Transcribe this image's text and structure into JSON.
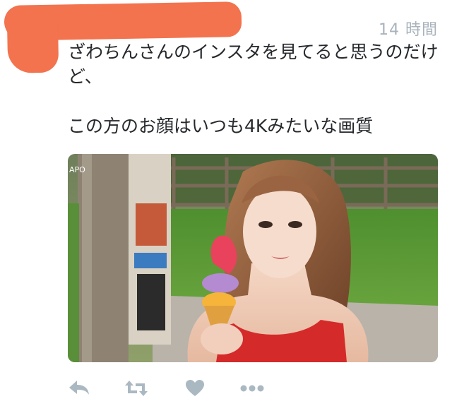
{
  "tweet": {
    "timestamp": "14 時間",
    "text": "ざわちんさんのインスタを見てると思うのだけど、\n\nこの方のお顔はいつも4Kみたいな画質"
  },
  "media": {
    "sign_text": "APO"
  },
  "actions": {
    "icons": [
      "reply-icon",
      "retweet-icon",
      "like-icon",
      "more-icon"
    ],
    "icon_color": "#aab8c2"
  },
  "colors": {
    "redaction": "#f3734e",
    "text": "#26292c",
    "timestamp": "#a9b3bc"
  }
}
